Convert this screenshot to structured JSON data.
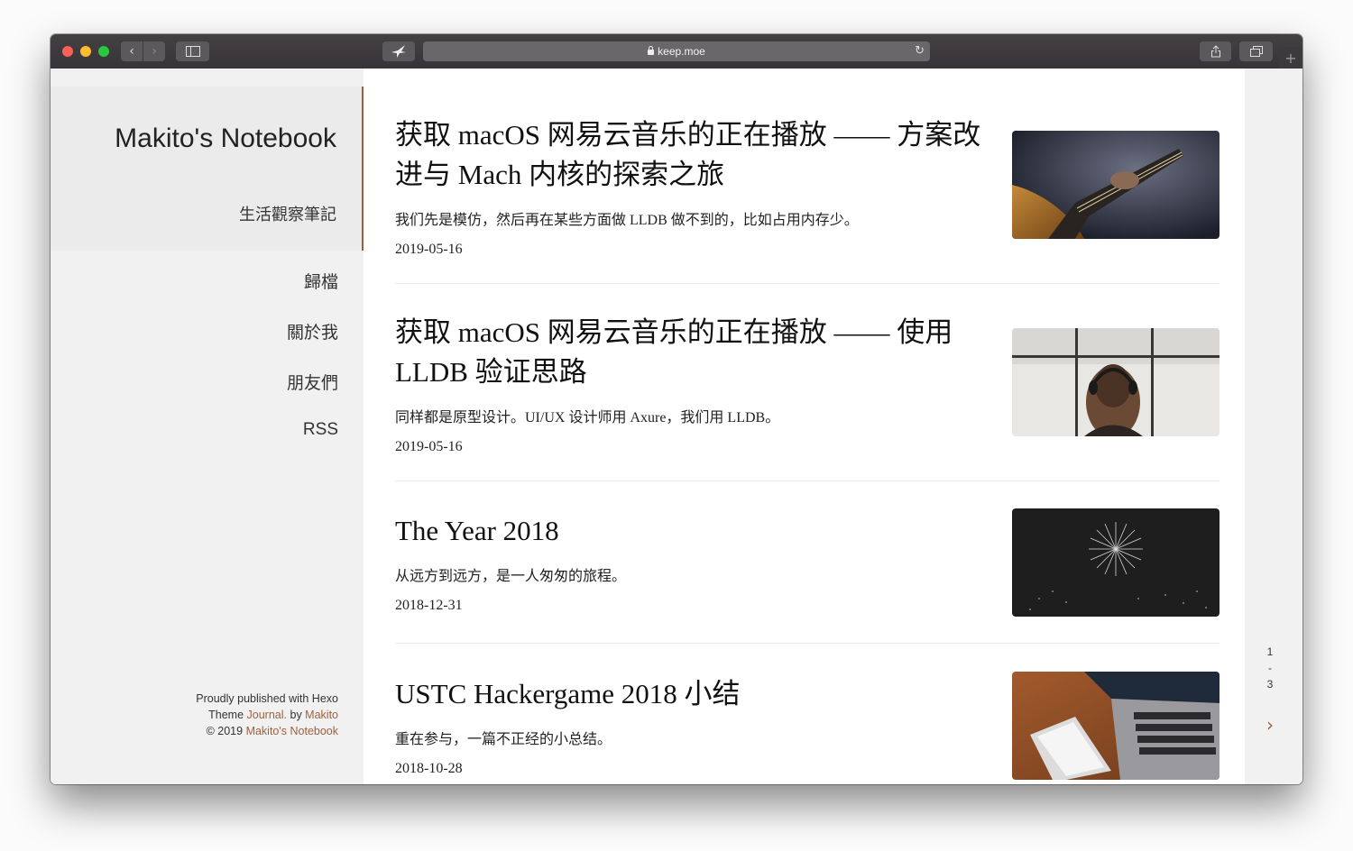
{
  "browser": {
    "url": "keep.moe"
  },
  "sidebar": {
    "site_title": "Makito's Notebook",
    "site_subtitle": "生活觀察筆記",
    "nav": [
      "歸檔",
      "關於我",
      "朋友們",
      "RSS"
    ],
    "footer": {
      "line1": "Proudly published with Hexo",
      "theme_prefix": "Theme ",
      "theme_name": "Journal.",
      "by_text": " by ",
      "author": "Makito",
      "copyright": "© 2019 ",
      "site_link": "Makito's Notebook"
    }
  },
  "posts": [
    {
      "title": "获取 macOS 网易云音乐的正在播放 —— 方案改进与 Mach 内核的探索之旅",
      "excerpt": "我们先是模仿，然后再在某些方面做 LLDB 做不到的，比如占用内存少。",
      "date": "2019-05-16",
      "thumb": "guitar-photo"
    },
    {
      "title": "获取 macOS 网易云音乐的正在播放 —— 使用 LLDB 验证思路",
      "excerpt": "同样都是原型设计。UI/UX 设计师用 Axure，我们用 LLDB。",
      "date": "2019-05-16",
      "thumb": "headphones-window-photo"
    },
    {
      "title": "The Year 2018",
      "excerpt": "从远方到远方，是一人匆匆的旅程。",
      "date": "2018-12-31",
      "thumb": "fireworks-photo"
    },
    {
      "title": "USTC Hackergame 2018 小结",
      "excerpt": "重在参与，一篇不正经的小总结。",
      "date": "2018-10-28",
      "thumb": "laptop-phone-photo"
    }
  ],
  "pagination": {
    "pages": [
      "1",
      "-",
      "3"
    ],
    "next": "›"
  },
  "colors": {
    "accent": "#a0603f",
    "chrome": "#3d3a3d"
  }
}
